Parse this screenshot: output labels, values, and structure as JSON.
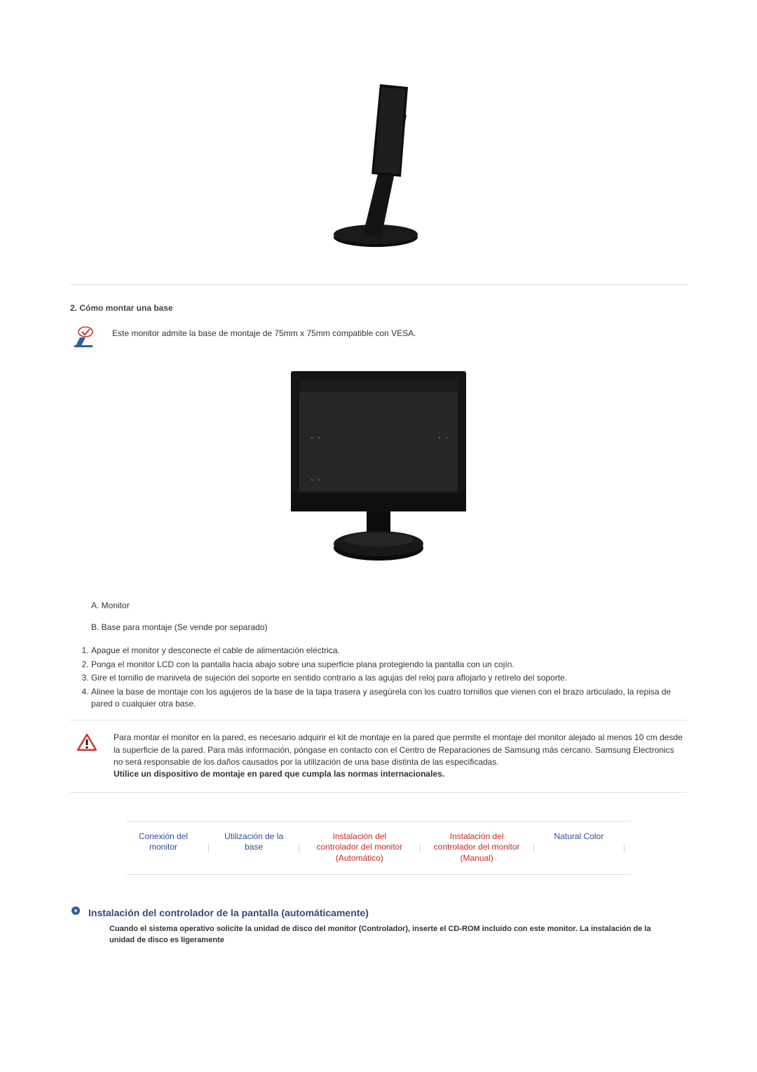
{
  "figure1": {
    "alt": "monitor-tilted-stand-side-view"
  },
  "section2": {
    "heading": "2. Cómo montar una base",
    "note": "Este monitor admite la base de montaje de 75mm x 75mm compatible con VESA."
  },
  "figure2": {
    "alt": "monitor-front-view-with-black-stand"
  },
  "descriptions": {
    "a": "A. Monitor",
    "b": "B. Base para montaje (Se vende por separado)"
  },
  "steps": [
    "Apague el monitor y desconecte el cable de alimentación eléctrica.",
    "Ponga el monitor LCD con la pantalla hacia abajo sobre una superficie plana protegiendo la pantalla con un cojín.",
    "Gire el tornillo de manivela de sujeción del soporte en sentido contrario a las agujas del reloj para aflojarlo y retírelo del soporte.",
    "Alinee la base de montaje con los agujeros de la base de la tapa trasera y asegúrela con los cuatro tornillos que vienen con el brazo articulado, la repisa de pared o cualquier otra base."
  ],
  "warning": {
    "text": "Para montar el monitor en la pared, es necesario adquirir el kit de montaje en la pared que permite el montaje del monitor alejado al menos 10 cm desde la superficie de la pared. Para más información, póngase en contacto con el Centro de Reparaciones de Samsung más cercano. Samsung Electronics no será responsable de los daños causados por la utilización de una base distinta de las especificadas.",
    "bold": "Utilice un dispositivo de montaje en pared que cumpla las normas internacionales."
  },
  "nav": {
    "items": [
      {
        "label": "Conexión del monitor"
      },
      {
        "label": "Utilización de la base"
      },
      {
        "label": "Instalación del controlador del monitor (Automático)"
      },
      {
        "label": "Instalación del controlador del monitor (Manual)"
      },
      {
        "label": "Natural Color"
      }
    ]
  },
  "final": {
    "heading": "Instalación del controlador de la pantalla (automáticamente)",
    "sub": "Cuando el sistema operativo solicite la unidad de disco del monitor (Controlador), inserte el CD-ROM incluido con este monitor. La instalación de la unidad de disco es ligeramente"
  }
}
